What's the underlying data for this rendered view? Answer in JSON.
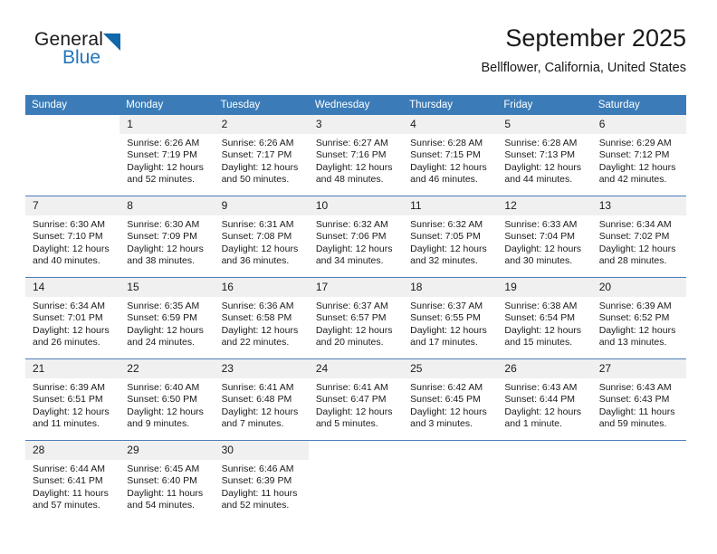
{
  "brand": {
    "name_part1": "General",
    "name_part2": "Blue",
    "triangle_color": "#1168ab",
    "blue_color": "#2275bb"
  },
  "header": {
    "title": "September 2025",
    "subtitle": "Bellflower, California, United States"
  },
  "calendar": {
    "header_bg": "#3b7cb8",
    "daynum_bg": "#f0f0f0",
    "row_divider_color": "#4a7ebb",
    "weekday_headers": [
      "Sunday",
      "Monday",
      "Tuesday",
      "Wednesday",
      "Thursday",
      "Friday",
      "Saturday"
    ],
    "weeks": [
      [
        {
          "day": "",
          "sunrise": "",
          "sunset": "",
          "daylight_line1": "",
          "daylight_line2": ""
        },
        {
          "day": "1",
          "sunrise": "Sunrise: 6:26 AM",
          "sunset": "Sunset: 7:19 PM",
          "daylight_line1": "Daylight: 12 hours",
          "daylight_line2": "and 52 minutes."
        },
        {
          "day": "2",
          "sunrise": "Sunrise: 6:26 AM",
          "sunset": "Sunset: 7:17 PM",
          "daylight_line1": "Daylight: 12 hours",
          "daylight_line2": "and 50 minutes."
        },
        {
          "day": "3",
          "sunrise": "Sunrise: 6:27 AM",
          "sunset": "Sunset: 7:16 PM",
          "daylight_line1": "Daylight: 12 hours",
          "daylight_line2": "and 48 minutes."
        },
        {
          "day": "4",
          "sunrise": "Sunrise: 6:28 AM",
          "sunset": "Sunset: 7:15 PM",
          "daylight_line1": "Daylight: 12 hours",
          "daylight_line2": "and 46 minutes."
        },
        {
          "day": "5",
          "sunrise": "Sunrise: 6:28 AM",
          "sunset": "Sunset: 7:13 PM",
          "daylight_line1": "Daylight: 12 hours",
          "daylight_line2": "and 44 minutes."
        },
        {
          "day": "6",
          "sunrise": "Sunrise: 6:29 AM",
          "sunset": "Sunset: 7:12 PM",
          "daylight_line1": "Daylight: 12 hours",
          "daylight_line2": "and 42 minutes."
        }
      ],
      [
        {
          "day": "7",
          "sunrise": "Sunrise: 6:30 AM",
          "sunset": "Sunset: 7:10 PM",
          "daylight_line1": "Daylight: 12 hours",
          "daylight_line2": "and 40 minutes."
        },
        {
          "day": "8",
          "sunrise": "Sunrise: 6:30 AM",
          "sunset": "Sunset: 7:09 PM",
          "daylight_line1": "Daylight: 12 hours",
          "daylight_line2": "and 38 minutes."
        },
        {
          "day": "9",
          "sunrise": "Sunrise: 6:31 AM",
          "sunset": "Sunset: 7:08 PM",
          "daylight_line1": "Daylight: 12 hours",
          "daylight_line2": "and 36 minutes."
        },
        {
          "day": "10",
          "sunrise": "Sunrise: 6:32 AM",
          "sunset": "Sunset: 7:06 PM",
          "daylight_line1": "Daylight: 12 hours",
          "daylight_line2": "and 34 minutes."
        },
        {
          "day": "11",
          "sunrise": "Sunrise: 6:32 AM",
          "sunset": "Sunset: 7:05 PM",
          "daylight_line1": "Daylight: 12 hours",
          "daylight_line2": "and 32 minutes."
        },
        {
          "day": "12",
          "sunrise": "Sunrise: 6:33 AM",
          "sunset": "Sunset: 7:04 PM",
          "daylight_line1": "Daylight: 12 hours",
          "daylight_line2": "and 30 minutes."
        },
        {
          "day": "13",
          "sunrise": "Sunrise: 6:34 AM",
          "sunset": "Sunset: 7:02 PM",
          "daylight_line1": "Daylight: 12 hours",
          "daylight_line2": "and 28 minutes."
        }
      ],
      [
        {
          "day": "14",
          "sunrise": "Sunrise: 6:34 AM",
          "sunset": "Sunset: 7:01 PM",
          "daylight_line1": "Daylight: 12 hours",
          "daylight_line2": "and 26 minutes."
        },
        {
          "day": "15",
          "sunrise": "Sunrise: 6:35 AM",
          "sunset": "Sunset: 6:59 PM",
          "daylight_line1": "Daylight: 12 hours",
          "daylight_line2": "and 24 minutes."
        },
        {
          "day": "16",
          "sunrise": "Sunrise: 6:36 AM",
          "sunset": "Sunset: 6:58 PM",
          "daylight_line1": "Daylight: 12 hours",
          "daylight_line2": "and 22 minutes."
        },
        {
          "day": "17",
          "sunrise": "Sunrise: 6:37 AM",
          "sunset": "Sunset: 6:57 PM",
          "daylight_line1": "Daylight: 12 hours",
          "daylight_line2": "and 20 minutes."
        },
        {
          "day": "18",
          "sunrise": "Sunrise: 6:37 AM",
          "sunset": "Sunset: 6:55 PM",
          "daylight_line1": "Daylight: 12 hours",
          "daylight_line2": "and 17 minutes."
        },
        {
          "day": "19",
          "sunrise": "Sunrise: 6:38 AM",
          "sunset": "Sunset: 6:54 PM",
          "daylight_line1": "Daylight: 12 hours",
          "daylight_line2": "and 15 minutes."
        },
        {
          "day": "20",
          "sunrise": "Sunrise: 6:39 AM",
          "sunset": "Sunset: 6:52 PM",
          "daylight_line1": "Daylight: 12 hours",
          "daylight_line2": "and 13 minutes."
        }
      ],
      [
        {
          "day": "21",
          "sunrise": "Sunrise: 6:39 AM",
          "sunset": "Sunset: 6:51 PM",
          "daylight_line1": "Daylight: 12 hours",
          "daylight_line2": "and 11 minutes."
        },
        {
          "day": "22",
          "sunrise": "Sunrise: 6:40 AM",
          "sunset": "Sunset: 6:50 PM",
          "daylight_line1": "Daylight: 12 hours",
          "daylight_line2": "and 9 minutes."
        },
        {
          "day": "23",
          "sunrise": "Sunrise: 6:41 AM",
          "sunset": "Sunset: 6:48 PM",
          "daylight_line1": "Daylight: 12 hours",
          "daylight_line2": "and 7 minutes."
        },
        {
          "day": "24",
          "sunrise": "Sunrise: 6:41 AM",
          "sunset": "Sunset: 6:47 PM",
          "daylight_line1": "Daylight: 12 hours",
          "daylight_line2": "and 5 minutes."
        },
        {
          "day": "25",
          "sunrise": "Sunrise: 6:42 AM",
          "sunset": "Sunset: 6:45 PM",
          "daylight_line1": "Daylight: 12 hours",
          "daylight_line2": "and 3 minutes."
        },
        {
          "day": "26",
          "sunrise": "Sunrise: 6:43 AM",
          "sunset": "Sunset: 6:44 PM",
          "daylight_line1": "Daylight: 12 hours",
          "daylight_line2": "and 1 minute."
        },
        {
          "day": "27",
          "sunrise": "Sunrise: 6:43 AM",
          "sunset": "Sunset: 6:43 PM",
          "daylight_line1": "Daylight: 11 hours",
          "daylight_line2": "and 59 minutes."
        }
      ],
      [
        {
          "day": "28",
          "sunrise": "Sunrise: 6:44 AM",
          "sunset": "Sunset: 6:41 PM",
          "daylight_line1": "Daylight: 11 hours",
          "daylight_line2": "and 57 minutes."
        },
        {
          "day": "29",
          "sunrise": "Sunrise: 6:45 AM",
          "sunset": "Sunset: 6:40 PM",
          "daylight_line1": "Daylight: 11 hours",
          "daylight_line2": "and 54 minutes."
        },
        {
          "day": "30",
          "sunrise": "Sunrise: 6:46 AM",
          "sunset": "Sunset: 6:39 PM",
          "daylight_line1": "Daylight: 11 hours",
          "daylight_line2": "and 52 minutes."
        },
        {
          "day": "",
          "sunrise": "",
          "sunset": "",
          "daylight_line1": "",
          "daylight_line2": ""
        },
        {
          "day": "",
          "sunrise": "",
          "sunset": "",
          "daylight_line1": "",
          "daylight_line2": ""
        },
        {
          "day": "",
          "sunrise": "",
          "sunset": "",
          "daylight_line1": "",
          "daylight_line2": ""
        },
        {
          "day": "",
          "sunrise": "",
          "sunset": "",
          "daylight_line1": "",
          "daylight_line2": ""
        }
      ]
    ]
  }
}
